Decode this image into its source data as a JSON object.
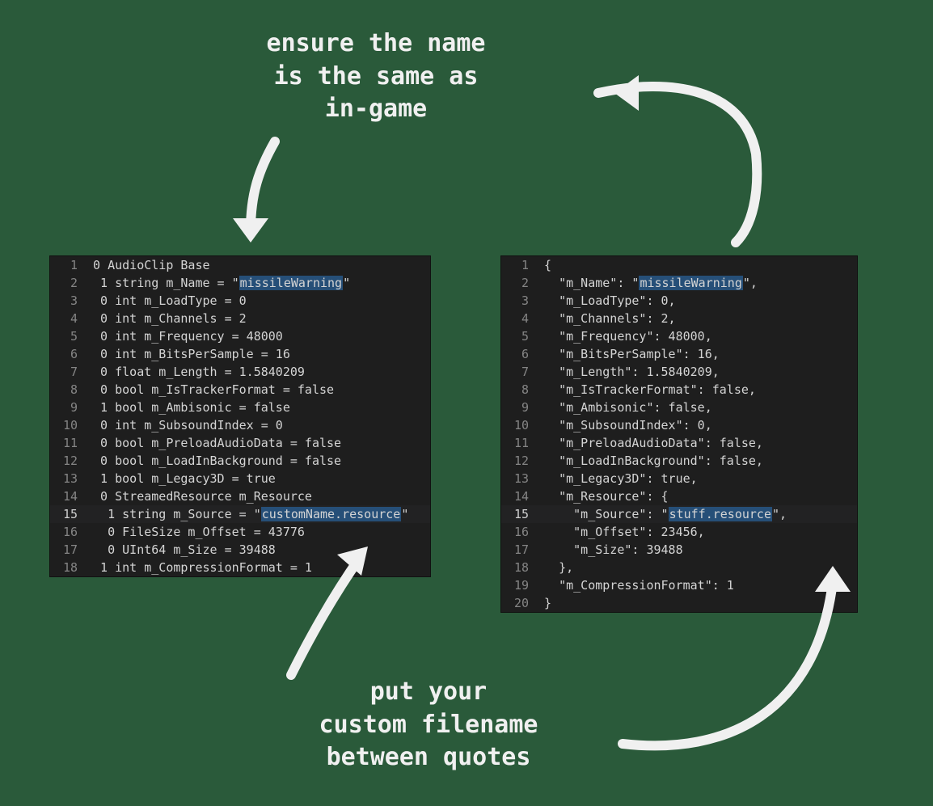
{
  "annotations": {
    "top": "ensure the name\nis the same as\nin-game",
    "bottom": "put your\ncustom filename\nbetween quotes"
  },
  "left_code": {
    "highlight_line": 15,
    "lines": [
      {
        "n": 1,
        "indent": " ",
        "pre": "0 AudioClip Base",
        "hl": "",
        "post": ""
      },
      {
        "n": 2,
        "indent": "  ",
        "pre": "1 string m_Name = \"",
        "hl": "missileWarning",
        "post": "\""
      },
      {
        "n": 3,
        "indent": "  ",
        "pre": "0 int m_LoadType = 0",
        "hl": "",
        "post": ""
      },
      {
        "n": 4,
        "indent": "  ",
        "pre": "0 int m_Channels = 2",
        "hl": "",
        "post": ""
      },
      {
        "n": 5,
        "indent": "  ",
        "pre": "0 int m_Frequency = 48000",
        "hl": "",
        "post": ""
      },
      {
        "n": 6,
        "indent": "  ",
        "pre": "0 int m_BitsPerSample = 16",
        "hl": "",
        "post": ""
      },
      {
        "n": 7,
        "indent": "  ",
        "pre": "0 float m_Length = 1.5840209",
        "hl": "",
        "post": ""
      },
      {
        "n": 8,
        "indent": "  ",
        "pre": "0 bool m_IsTrackerFormat = false",
        "hl": "",
        "post": ""
      },
      {
        "n": 9,
        "indent": "  ",
        "pre": "1 bool m_Ambisonic = false",
        "hl": "",
        "post": ""
      },
      {
        "n": 10,
        "indent": "  ",
        "pre": "0 int m_SubsoundIndex = 0",
        "hl": "",
        "post": ""
      },
      {
        "n": 11,
        "indent": "  ",
        "pre": "0 bool m_PreloadAudioData = false",
        "hl": "",
        "post": ""
      },
      {
        "n": 12,
        "indent": "  ",
        "pre": "0 bool m_LoadInBackground = false",
        "hl": "",
        "post": ""
      },
      {
        "n": 13,
        "indent": "  ",
        "pre": "1 bool m_Legacy3D = true",
        "hl": "",
        "post": ""
      },
      {
        "n": 14,
        "indent": "  ",
        "pre": "0 StreamedResource m_Resource",
        "hl": "",
        "post": ""
      },
      {
        "n": 15,
        "indent": "   ",
        "pre": "1 string m_Source = \"",
        "hl": "customName.resource",
        "post": "\""
      },
      {
        "n": 16,
        "indent": "   ",
        "pre": "0 FileSize m_Offset = 43776",
        "hl": "",
        "post": ""
      },
      {
        "n": 17,
        "indent": "   ",
        "pre": "0 UInt64 m_Size = 39488",
        "hl": "",
        "post": ""
      },
      {
        "n": 18,
        "indent": "  ",
        "pre": "1 int m_CompressionFormat = 1",
        "hl": "",
        "post": ""
      }
    ]
  },
  "right_code": {
    "highlight_line": 15,
    "lines": [
      {
        "n": 1,
        "indent": " ",
        "pre": "{",
        "hl": "",
        "post": ""
      },
      {
        "n": 2,
        "indent": "   ",
        "pre": "\"m_Name\": \"",
        "hl": "missileWarning",
        "post": "\","
      },
      {
        "n": 3,
        "indent": "   ",
        "pre": "\"m_LoadType\": 0,",
        "hl": "",
        "post": ""
      },
      {
        "n": 4,
        "indent": "   ",
        "pre": "\"m_Channels\": 2,",
        "hl": "",
        "post": ""
      },
      {
        "n": 5,
        "indent": "   ",
        "pre": "\"m_Frequency\": 48000,",
        "hl": "",
        "post": ""
      },
      {
        "n": 6,
        "indent": "   ",
        "pre": "\"m_BitsPerSample\": 16,",
        "hl": "",
        "post": ""
      },
      {
        "n": 7,
        "indent": "   ",
        "pre": "\"m_Length\": 1.5840209,",
        "hl": "",
        "post": ""
      },
      {
        "n": 8,
        "indent": "   ",
        "pre": "\"m_IsTrackerFormat\": false,",
        "hl": "",
        "post": ""
      },
      {
        "n": 9,
        "indent": "   ",
        "pre": "\"m_Ambisonic\": false,",
        "hl": "",
        "post": ""
      },
      {
        "n": 10,
        "indent": "   ",
        "pre": "\"m_SubsoundIndex\": 0,",
        "hl": "",
        "post": ""
      },
      {
        "n": 11,
        "indent": "   ",
        "pre": "\"m_PreloadAudioData\": false,",
        "hl": "",
        "post": ""
      },
      {
        "n": 12,
        "indent": "   ",
        "pre": "\"m_LoadInBackground\": false,",
        "hl": "",
        "post": ""
      },
      {
        "n": 13,
        "indent": "   ",
        "pre": "\"m_Legacy3D\": true,",
        "hl": "",
        "post": ""
      },
      {
        "n": 14,
        "indent": "   ",
        "pre": "\"m_Resource\": {",
        "hl": "",
        "post": ""
      },
      {
        "n": 15,
        "indent": "     ",
        "pre": "\"m_Source\": \"",
        "hl": "stuff.resource",
        "post": "\","
      },
      {
        "n": 16,
        "indent": "     ",
        "pre": "\"m_Offset\": 23456,",
        "hl": "",
        "post": ""
      },
      {
        "n": 17,
        "indent": "     ",
        "pre": "\"m_Size\": 39488",
        "hl": "",
        "post": ""
      },
      {
        "n": 18,
        "indent": "   ",
        "pre": "},",
        "hl": "",
        "post": ""
      },
      {
        "n": 19,
        "indent": "   ",
        "pre": "\"m_CompressionFormat\": 1",
        "hl": "",
        "post": ""
      },
      {
        "n": 20,
        "indent": " ",
        "pre": "}",
        "hl": "",
        "post": ""
      }
    ]
  }
}
